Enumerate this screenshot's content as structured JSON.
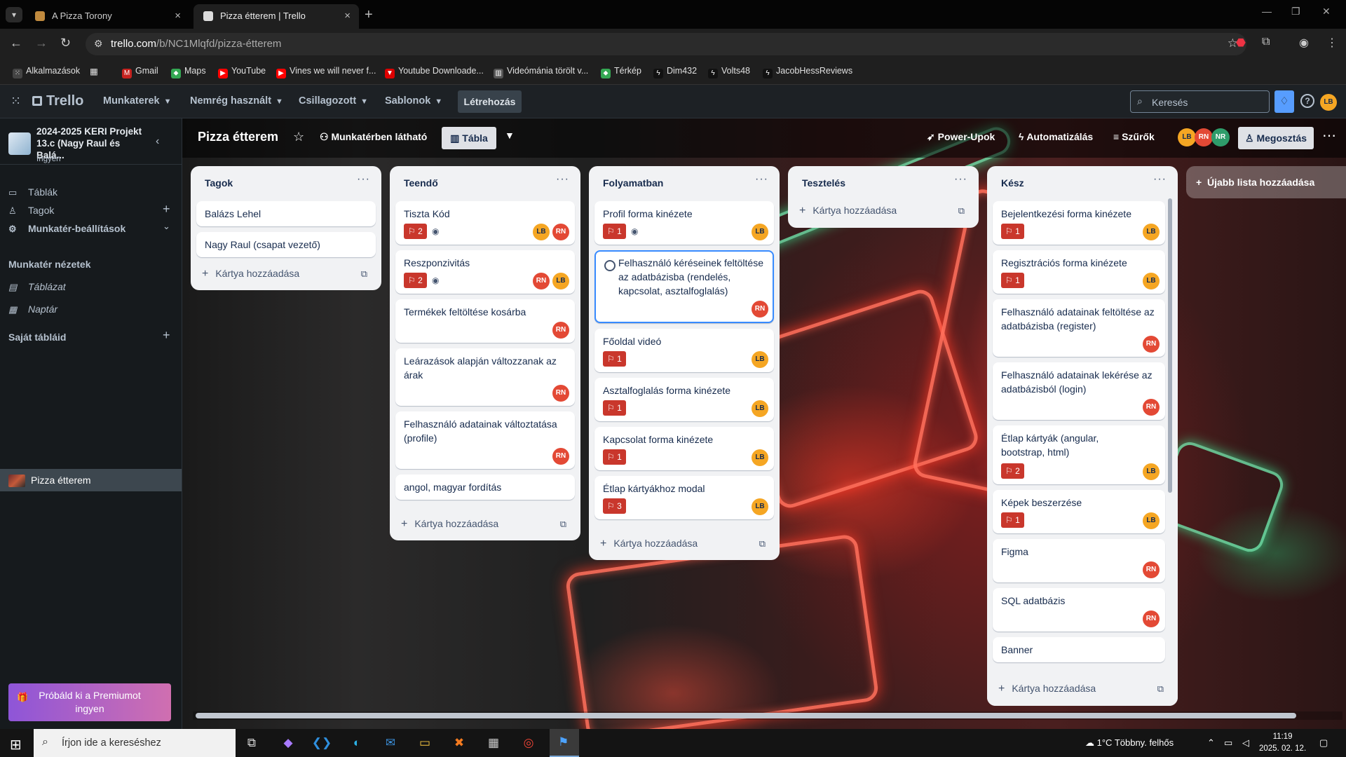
{
  "browser": {
    "tabs": [
      {
        "title": "A Pizza Torony",
        "active": false
      },
      {
        "title": "Pizza étterem | Trello",
        "active": true
      }
    ],
    "url_host": "trello.com",
    "url_path": "/b/NC1Mlqfd/pizza-étterem",
    "bookmarks": [
      "Alkalmazások",
      "Gmail",
      "Maps",
      "YouTube",
      "Vines we will never f...",
      "Youtube Downloade...",
      "Videómánia törölt v...",
      "Térkép",
      "Dim432",
      "Volts48",
      "JacobHessReviews"
    ]
  },
  "trello_header": {
    "logo": "Trello",
    "nav": [
      "Munkaterek",
      "Nemrég használt",
      "Csillagozott",
      "Sablonok"
    ],
    "create": "Létrehozás",
    "search_placeholder": "Keresés",
    "user_avatar": "LB"
  },
  "sidebar": {
    "workspace_name": "2024-2025 KERI Projekt 13.c (Nagy Raul és Balá...",
    "workspace_plan": "Ingyen",
    "items": [
      "Táblák",
      "Tagok",
      "Munkatér-beállítások"
    ],
    "views_heading": "Munkatér nézetek",
    "views": [
      "Táblázat",
      "Naptár"
    ],
    "boards_heading": "Saját tábláid",
    "boards": [
      "Pizza étterem"
    ],
    "premium": "Próbáld ki a Premiumot ingyen"
  },
  "board_header": {
    "title": "Pizza étterem",
    "visibility": "Munkatérben látható",
    "view": "Tábla",
    "powerups": "Power-Upok",
    "automation": "Automatizálás",
    "filters": "Szűrők",
    "members": [
      "LB",
      "RN",
      "NR"
    ],
    "share": "Megosztás"
  },
  "lists": [
    {
      "title": "Tagok",
      "cards": [
        {
          "title": "Balázs Lehel"
        },
        {
          "title": "Nagy Raul (csapat vezető)"
        }
      ]
    },
    {
      "title": "Teendő",
      "cards": [
        {
          "title": "Tiszta Kód",
          "badge": "2",
          "members": [
            "LB",
            "RN"
          ]
        },
        {
          "title": "Reszponzivitás",
          "badge": "2",
          "members": [
            "RN",
            "LB"
          ]
        },
        {
          "title": "Termékek feltöltése kosárba",
          "members": [
            "RN"
          ]
        },
        {
          "title": "Leárazások alapján változzanak az árak",
          "members": [
            "RN"
          ]
        },
        {
          "title": "Felhasználó adatainak változtatása (profile)",
          "members": [
            "RN"
          ]
        },
        {
          "title": "angol, magyar fordítás"
        }
      ]
    },
    {
      "title": "Folyamatban",
      "cards": [
        {
          "title": "Profil forma kinézete",
          "badge": "1",
          "members": [
            "LB"
          ]
        },
        {
          "title": "Felhasználó kéréseinek feltöltése az adatbázisba (rendelés, kapcsolat, asztalfoglalás)",
          "members": [
            "RN"
          ]
        },
        {
          "title": "Főoldal videó",
          "badge": "1",
          "members": [
            "LB"
          ]
        },
        {
          "title": "Asztalfoglalás forma kinézete",
          "badge": "1",
          "members": [
            "LB"
          ]
        },
        {
          "title": "Kapcsolat forma kinézete",
          "badge": "1",
          "members": [
            "LB"
          ]
        },
        {
          "title": "Étlap kártyákhoz modal",
          "badge": "3",
          "members": [
            "LB"
          ]
        }
      ]
    },
    {
      "title": "Tesztelés",
      "cards": []
    },
    {
      "title": "Kész",
      "cards": [
        {
          "title": "Bejelentkezési forma kinézete",
          "badge": "1",
          "members": [
            "LB"
          ]
        },
        {
          "title": "Regisztrációs forma kinézete",
          "badge": "1",
          "members": [
            "LB"
          ]
        },
        {
          "title": "Felhasználó adatainak feltöltése az adatbázisba (register)",
          "members": [
            "RN"
          ]
        },
        {
          "title": "Felhasználó adatainak lekérése az adatbázisból (login)",
          "members": [
            "RN"
          ]
        },
        {
          "title": "Étlap kártyák (angular, bootstrap, html)",
          "badge": "2",
          "members": [
            "LB"
          ]
        },
        {
          "title": "Képek beszerzése",
          "badge": "1",
          "members": [
            "LB"
          ]
        },
        {
          "title": "Figma",
          "members": [
            "RN"
          ]
        },
        {
          "title": "SQL adatbázis",
          "members": [
            "RN"
          ]
        },
        {
          "title": "Banner"
        }
      ]
    }
  ],
  "add_card_label": "Kártya hozzáadása",
  "add_list_label": "Újabb lista hozzáadása",
  "taskbar": {
    "search_placeholder": "Írjon ide a kereséshez",
    "weather": "1°C  Többny. felhős",
    "time": "11:19",
    "date": "2025. 02. 12."
  },
  "colors": {
    "badge_red": "#c9372c",
    "avatar_lb": "#f5a623",
    "avatar_rn": "#e34935",
    "avatar_nr": "#2e9c6a",
    "selected_border": "#388bff"
  }
}
